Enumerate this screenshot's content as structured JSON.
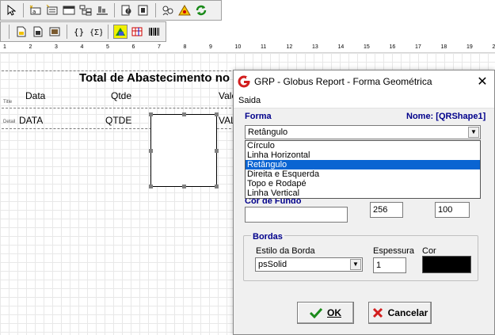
{
  "toolbar1": {
    "icons": [
      "select-arrow-icon",
      "new-label-icon",
      "new-text-icon",
      "new-band-icon",
      "band-tree-icon",
      "align-icon",
      "preview-icon",
      "page-setup-icon",
      "users-icon",
      "warning-icon",
      "refresh-icon"
    ]
  },
  "toolbar2": {
    "icons": [
      "new-report-icon",
      "open-report-icon",
      "image-icon",
      "curly-braces-icon",
      "expression-icon",
      "shape-icon",
      "table-icon",
      "barcode-icon"
    ]
  },
  "ruler": {
    "numbers": [
      "1",
      "2",
      "3",
      "4",
      "5",
      "6",
      "7",
      "8",
      "9",
      "10",
      "11",
      "12",
      "13",
      "14",
      "15",
      "16",
      "17",
      "18",
      "19",
      "2"
    ]
  },
  "report": {
    "title": "Total de Abastecimento no Mês",
    "title_band_label": "Title",
    "detail_band_label": "Detail",
    "header_fields": [
      "Data",
      "Qtde",
      "Valor"
    ],
    "detail_fields": [
      "DATA",
      "QTDE",
      "VALOR"
    ]
  },
  "dialog": {
    "title": "GRP - Globus Report - Forma Geométrica",
    "menu": "Saida",
    "forma_label": "Forma",
    "name_label": "Nome: [QRShape1]",
    "forma_value": "Retângulo",
    "options": [
      "Círculo",
      "Linha Horizontal",
      "Retângulo",
      "Direita e Esquerda",
      "Topo e Rodapé",
      "Linha Vertical"
    ],
    "selected_index": 2,
    "cor_fundo_label": "Cor de Fundo",
    "width_value": "256",
    "height_value": "100",
    "bordas_label": "Bordas",
    "estilo_label": "Estilo da Borda",
    "estilo_value": "psSolid",
    "espessura_label": "Espessura",
    "espessura_value": "1",
    "cor_label": "Cor",
    "ok_label": "OK",
    "cancel_label": "Cancelar"
  },
  "colors": {
    "accent_blue": "#00008b",
    "selection": "#0a64d2",
    "border_color": "#000000"
  }
}
